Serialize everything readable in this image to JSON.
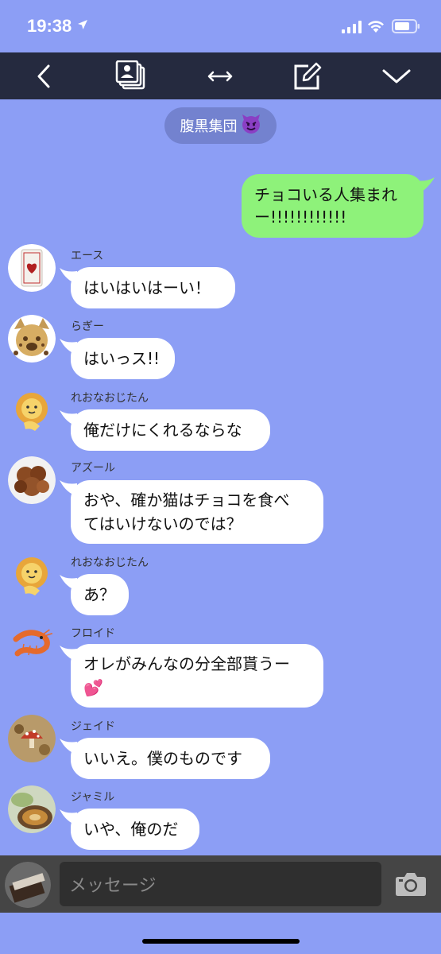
{
  "status": {
    "time": "19:38"
  },
  "group": {
    "name": "腹黒集団",
    "emoji": "😈"
  },
  "sent": {
    "text": "チョコいる人集まれー!!!!!!!!!!!!"
  },
  "messages": [
    {
      "sender": "エース",
      "text": "はいはいはーい！",
      "avatar": "playing-card"
    },
    {
      "sender": "らぎー",
      "text": "はいっス!!",
      "avatar": "hyena"
    },
    {
      "sender": "れおなおじたん",
      "text": "俺だけにくれるならな",
      "avatar": "lion"
    },
    {
      "sender": "アズール",
      "text": "おや、確か猫はチョコを食べてはいけないのでは？",
      "line1": "おや、確か猫はチョコを食べ",
      "line2": "てはいけないのでは？",
      "avatar": "food"
    },
    {
      "sender": "れおなおじたん",
      "text": "あ？",
      "avatar": "lion"
    },
    {
      "sender": "フロイド",
      "text": "オレがみんなの分全部貰うー💕",
      "line1": "オレがみんなの分全部貰うー",
      "line2": "💕",
      "avatar": "shrimp"
    },
    {
      "sender": "ジェイド",
      "text": "いいえ。僕のものです",
      "avatar": "mushroom"
    },
    {
      "sender": "ジャミル",
      "text": "いや、俺のだ",
      "avatar": "curry"
    }
  ],
  "input": {
    "placeholder": "メッセージ"
  },
  "colors": {
    "background": "#8c9ef5",
    "toolbar": "#252a3f",
    "sent_bubble": "#8ef27a",
    "input_bar": "#454545"
  },
  "icons": [
    "back-icon",
    "contacts-icon",
    "expand-icon",
    "compose-icon",
    "chevron-down-icon",
    "camera-icon"
  ]
}
